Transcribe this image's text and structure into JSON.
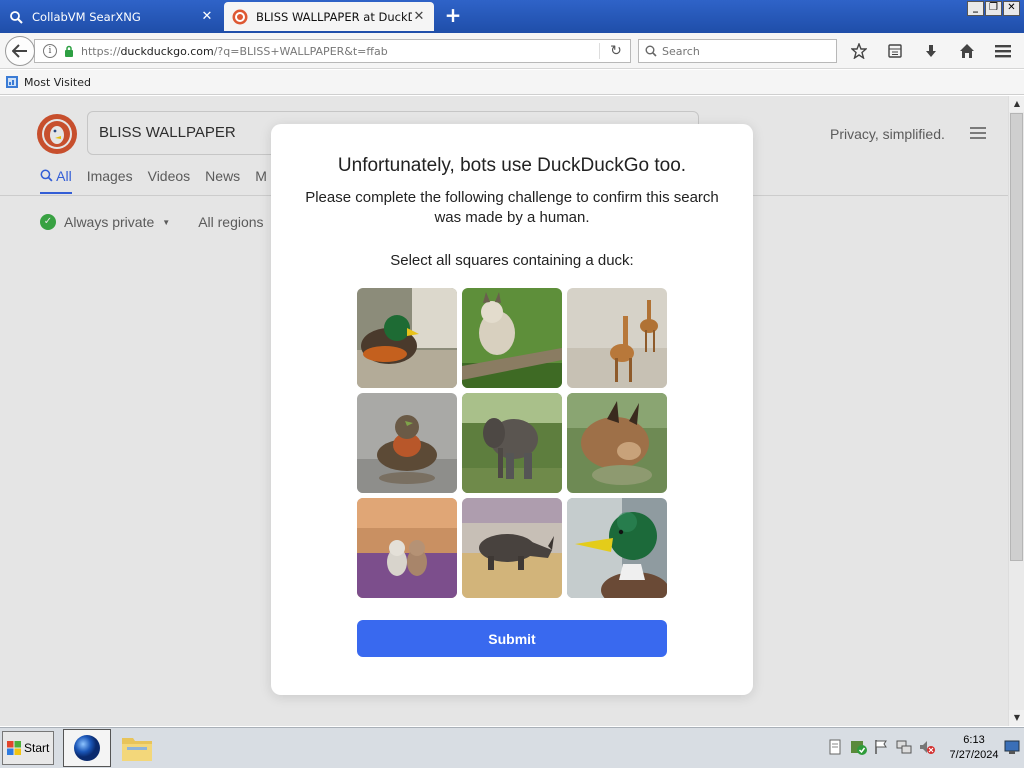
{
  "window": {
    "tabs": [
      {
        "title": "CollabVM SearXNG",
        "active": false
      },
      {
        "title": "BLISS WALLPAPER at DuckDu...",
        "active": true
      }
    ],
    "new_tab_label": "+",
    "controls": {
      "minimize": "_",
      "restore": "❐",
      "close": "✕"
    }
  },
  "navbar": {
    "url_prefix": "https://",
    "url_host": "duckduckgo.com",
    "url_path": "/?q=BLISS+WALLPAPER&t=ffab",
    "search_placeholder": "Search",
    "icons": [
      "star-icon",
      "library-icon",
      "download-icon",
      "home-icon",
      "hamburger-menu-icon"
    ]
  },
  "bookmarks": {
    "most_visited": "Most Visited"
  },
  "ddg": {
    "search_value": "BLISS WALLPAPER",
    "tagline": "Privacy, simplified.",
    "tabs": [
      "All",
      "Images",
      "Videos",
      "News",
      "M"
    ],
    "filter_private": "Always private",
    "filter_region": "All regions"
  },
  "modal": {
    "title": "Unfortunately, bots use DuckDuckGo too.",
    "subtitle": "Please complete the following challenge to confirm this search was made by a human.",
    "instruction": "Select all squares containing a duck:",
    "tiles": [
      "duck",
      "lynx",
      "giraffes",
      "duck",
      "elephant",
      "caracal",
      "cats",
      "rhino",
      "duck"
    ],
    "submit_label": "Submit"
  },
  "taskbar": {
    "start_label": "Start",
    "clock_time": "6:13",
    "clock_date": "7/27/2024"
  },
  "colors": {
    "accent": "#3969ef",
    "ddg_brand": "#de5833",
    "tabbar": "#2f63c8"
  }
}
